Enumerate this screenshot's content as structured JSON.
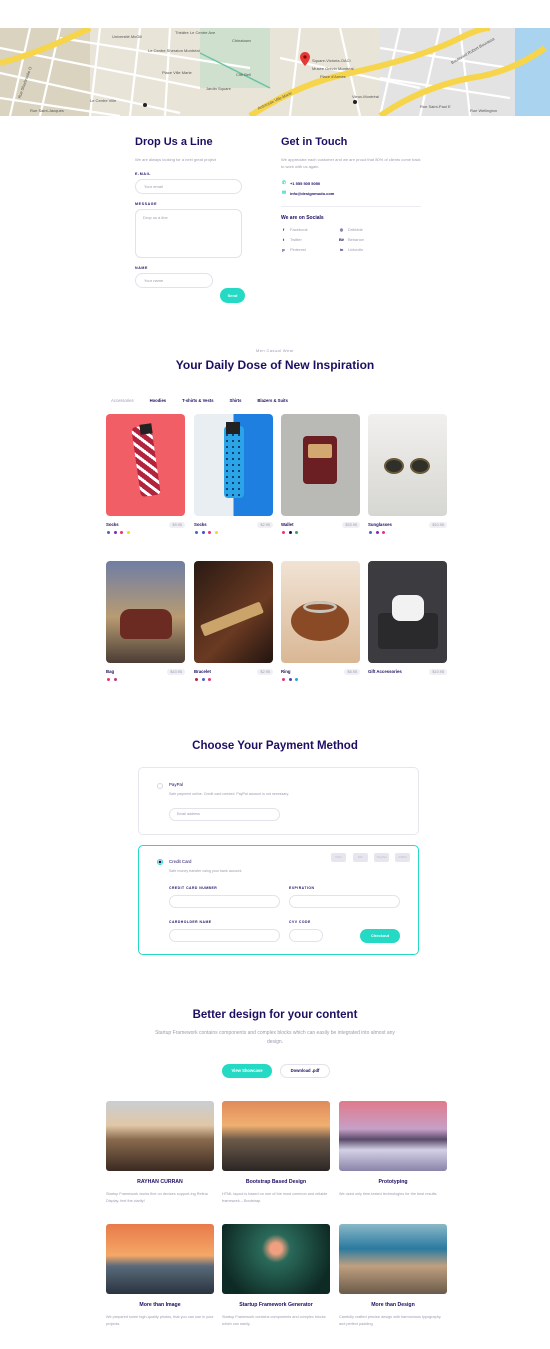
{
  "map": {
    "labels": [
      "Rue Sherbrooke O",
      "Théâtre Le Centre Ave",
      "Université McGill",
      "Chinatown",
      "Cité Bell",
      "Jardin Square",
      "Place Ville Marie",
      "Place d'Armes",
      "Le Centre Sheraton Montréal",
      "Vieux-Montréal",
      "Autoroute Ville-Marie",
      "Square-Victoria-OACI",
      "Rue Wellington",
      "Musée Grévin Montréal",
      "Rue Saint-Paul E",
      "Boulevard Robert-Bourassa",
      "Rue Saint-Jacques",
      "Le Centre Ville"
    ]
  },
  "contact": {
    "form_title": "Drop Us a Line",
    "form_intro": "We are always looking for a next great project",
    "email_label": "E-MAIL",
    "email_placeholder": "Your email",
    "message_label": "MESSAGE",
    "message_placeholder": "Drop us a line",
    "name_label": "NAME",
    "name_placeholder": "Your name",
    "send_label": "Send",
    "touch_title": "Get in Touch",
    "touch_intro": "We appreciate each customer and we are proud that 80% of clients come back to work with us again.",
    "phone": "+1 555 505 5050",
    "email": "info@designmodo.com",
    "socials_title": "We are on Socials",
    "socials": [
      {
        "icon": "facebook-icon",
        "glyph": "f",
        "label": "Facebook"
      },
      {
        "icon": "dribbble-icon",
        "glyph": "◎",
        "label": "Dribbble"
      },
      {
        "icon": "twitter-icon",
        "glyph": "t",
        "label": "Twitter"
      },
      {
        "icon": "behance-icon",
        "glyph": "Bē",
        "label": "Behance"
      },
      {
        "icon": "pinterest-icon",
        "glyph": "p",
        "label": "Pinterest"
      },
      {
        "icon": "linkedin-icon",
        "glyph": "in",
        "label": "LinkedIn"
      }
    ]
  },
  "shop": {
    "eyebrow": "Men Casual Wear",
    "title": "Your Daily Dose of New Inspiration",
    "tabs": [
      "Accessories",
      "Hoodies",
      "T-shirts & Vests",
      "Shirts",
      "Blazers & Suits"
    ],
    "products": [
      {
        "name": "Socks",
        "price": "$9.95",
        "swatches": [
          "#4a63c9",
          "#7a2fb0",
          "#e8327a",
          "#f7d71a"
        ]
      },
      {
        "name": "Socks",
        "price": "$2.95",
        "swatches": [
          "#4a63c9",
          "#3a4ed0",
          "#e8327a",
          "#f7d71a"
        ]
      },
      {
        "name": "Wallet",
        "price": "$33.95",
        "swatches": [
          "#e8327a",
          "#1e0e62",
          "#25a95a"
        ]
      },
      {
        "name": "Sunglasses",
        "price": "$10.95",
        "swatches": [
          "#4a63c9",
          "#7a2fb0",
          "#e8327a"
        ]
      },
      {
        "name": "Bag",
        "price": "$43.95",
        "swatches": [
          "#e8327a",
          "#c0347a"
        ]
      },
      {
        "name": "Bracelet",
        "price": "$2.95",
        "swatches": [
          "#b0243e",
          "#4a63c9",
          "#e8327a"
        ]
      },
      {
        "name": "Ring",
        "price": "$6.95",
        "swatches": [
          "#e8327a",
          "#4a4a9a",
          "#2aa0d8"
        ]
      },
      {
        "name": "Gift Accessories",
        "price": "$10.95",
        "swatches": []
      }
    ]
  },
  "payment": {
    "title": "Choose Your Payment Method",
    "paypal_title": "PayPal",
    "paypal_sub": "Safe payment online. Credit card needed. PayPal account is not necessary.",
    "paypal_placeholder": "Email address",
    "card_title": "Credit Card",
    "card_sub": "Safe money transfer using your bank account.",
    "card_logos": [
      "VISA",
      "MC",
      "PayPal",
      "AMEX"
    ],
    "card_number_label": "CREDIT CARD NUMBER",
    "expiration_label": "EXPIRATION",
    "holder_label": "CARDHOLDER NAME",
    "cvv_label": "CVV CODE",
    "checkout_label": "Checkout"
  },
  "showcase": {
    "title": "Better design for your content",
    "subtitle": "Startup Framework contains components and complex blocks which can easily be integrated into almost any design.",
    "primary_label": "View Showcase",
    "secondary_label": "Download .pdf",
    "cards": [
      {
        "title": "RAYHAN CURRAN",
        "text": "Startup Framework works fine on devices support-ing Retina Display. feel the clarity!"
      },
      {
        "title": "Bootstrap Based Design",
        "text": "HTML layout is based on one of the most common and reliable framework – Bootstrap."
      },
      {
        "title": "Prototyping",
        "text": "We used only time-tested technologies for the best results."
      },
      {
        "title": "More than Image",
        "text": "We prepared some high-quality photos, that you can use in your projects."
      },
      {
        "title": "Startup Framework Generator",
        "text": "Startup Framework contains components and complex blocks which can easily."
      },
      {
        "title": "More than Design",
        "text": "Carefully crafted precise design with harmonious typography and perfect padding."
      }
    ]
  }
}
